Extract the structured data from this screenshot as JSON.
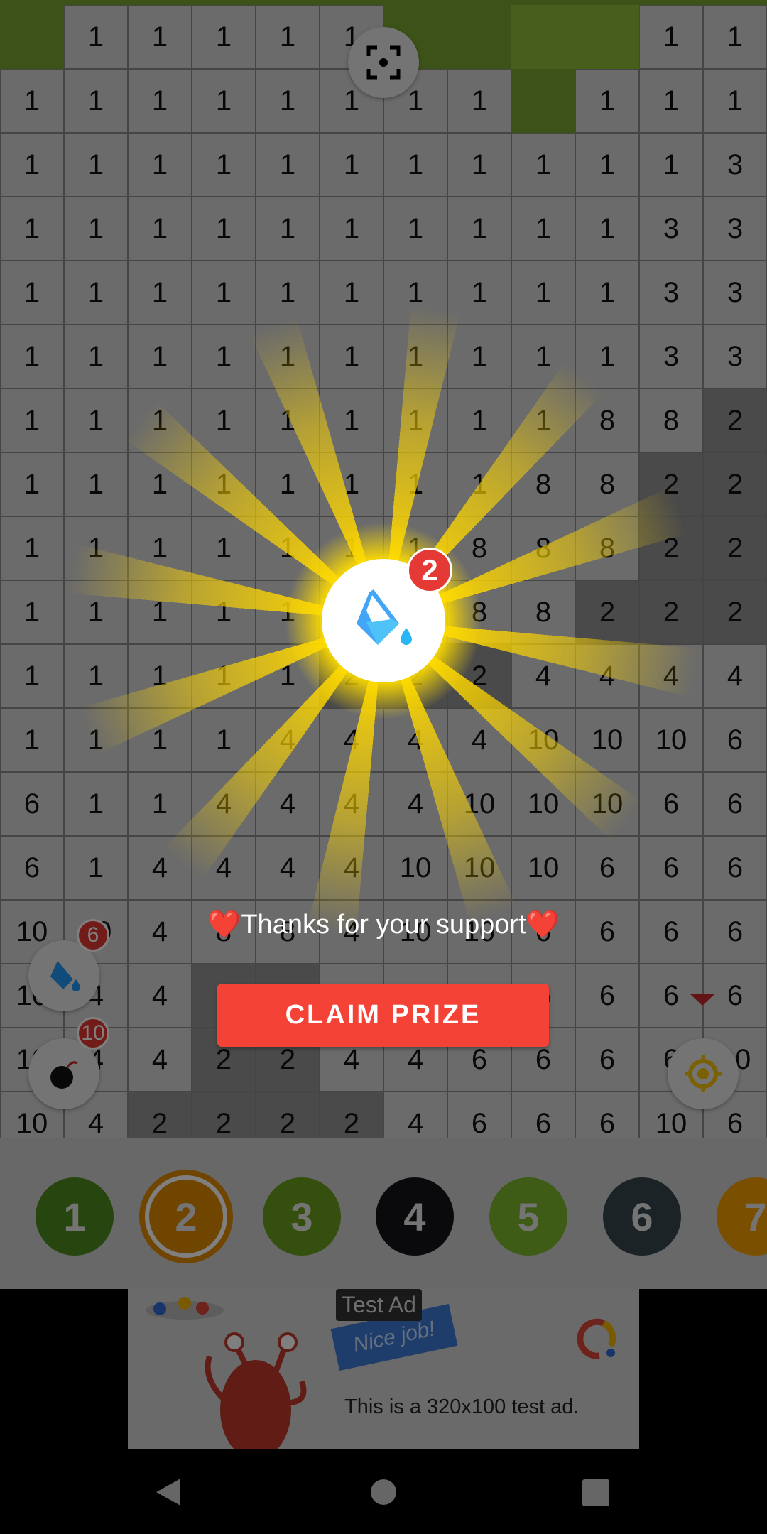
{
  "board": {
    "selected_number": "2",
    "rows": [
      [
        "",
        "1",
        "1",
        "1",
        "1",
        "1",
        "",
        "",
        "",
        "",
        "1",
        "1"
      ],
      [
        "1",
        "1",
        "1",
        "1",
        "1",
        "1",
        "1",
        "1",
        "",
        "1",
        "1",
        "1"
      ],
      [
        "1",
        "1",
        "1",
        "1",
        "1",
        "1",
        "1",
        "1",
        "1",
        "1",
        "1",
        "3"
      ],
      [
        "1",
        "1",
        "1",
        "1",
        "1",
        "1",
        "1",
        "1",
        "1",
        "1",
        "3",
        "3"
      ],
      [
        "1",
        "1",
        "1",
        "1",
        "1",
        "1",
        "1",
        "1",
        "1",
        "1",
        "3",
        "3"
      ],
      [
        "1",
        "1",
        "1",
        "1",
        "1",
        "1",
        "1",
        "1",
        "1",
        "1",
        "3",
        "3"
      ],
      [
        "1",
        "1",
        "1",
        "1",
        "1",
        "1",
        "1",
        "1",
        "1",
        "8",
        "8",
        "2"
      ],
      [
        "1",
        "1",
        "1",
        "1",
        "1",
        "1",
        "1",
        "1",
        "8",
        "8",
        "2",
        "2"
      ],
      [
        "1",
        "1",
        "1",
        "1",
        "1",
        "1",
        "1",
        "8",
        "8",
        "8",
        "2",
        "2"
      ],
      [
        "1",
        "1",
        "1",
        "1",
        "1",
        "1",
        "1",
        "8",
        "8",
        "2",
        "2",
        "2"
      ],
      [
        "1",
        "1",
        "1",
        "1",
        "1",
        "2",
        "2",
        "2",
        "4",
        "4",
        "4",
        "4"
      ],
      [
        "1",
        "1",
        "1",
        "1",
        "4",
        "4",
        "4",
        "4",
        "10",
        "10",
        "10",
        "6"
      ],
      [
        "6",
        "1",
        "1",
        "4",
        "4",
        "4",
        "4",
        "10",
        "10",
        "10",
        "6",
        "6"
      ],
      [
        "6",
        "1",
        "4",
        "4",
        "4",
        "4",
        "10",
        "10",
        "10",
        "6",
        "6",
        "6"
      ],
      [
        "10",
        "10",
        "4",
        "8",
        "8",
        "4",
        "10",
        "10",
        "6",
        "6",
        "6",
        "6"
      ],
      [
        "10",
        "4",
        "4",
        "2",
        "2",
        "4",
        "4",
        "6",
        "6",
        "6",
        "6",
        "6"
      ],
      [
        "10",
        "4",
        "4",
        "2",
        "2",
        "4",
        "4",
        "6",
        "6",
        "6",
        "6",
        "10"
      ],
      [
        "10",
        "4",
        "2",
        "2",
        "2",
        "2",
        "4",
        "6",
        "6",
        "6",
        "10",
        "6"
      ]
    ]
  },
  "tools": {
    "focus_icon": "focus-target-icon",
    "fill_bucket_count": "6",
    "bomb_count": "10",
    "locate_icon": "crosshair-icon"
  },
  "prize": {
    "icon": "paint-bucket-icon",
    "count": "2",
    "message": "❤️Thanks for your support❤️",
    "claim_label": "CLAIM PRIZE"
  },
  "palette": [
    {
      "number": "1",
      "color": "#4e8c1e"
    },
    {
      "number": "2",
      "color": "#e08a00",
      "selected": true
    },
    {
      "number": "3",
      "color": "#6a9f1c"
    },
    {
      "number": "4",
      "color": "#15151a"
    },
    {
      "number": "5",
      "color": "#7cb82a"
    },
    {
      "number": "6",
      "color": "#37474f"
    },
    {
      "number": "7",
      "color": "#f5a000"
    }
  ],
  "ad": {
    "label": "Test Ad",
    "banner": "Nice job!",
    "text": "This is a 320x100 test ad."
  },
  "colors": {
    "accent": "#f44336",
    "highlight_ray": "#ffd700"
  }
}
